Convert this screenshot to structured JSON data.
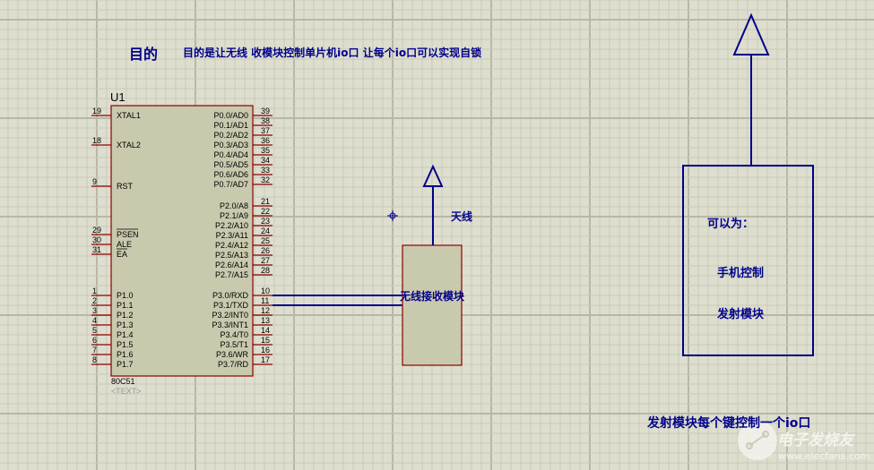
{
  "title": {
    "heading": "目的",
    "text": "目的是让无线 收模块控制单片机io口  让每个io口可以实现自锁"
  },
  "chip": {
    "ref": "U1",
    "part": "80C51",
    "text_placeholder": "<TEXT>",
    "left_pins": [
      {
        "num": "19",
        "name": "XTAL1"
      },
      {
        "num": "18",
        "name": "XTAL2"
      },
      {
        "num": "9",
        "name": "RST"
      },
      {
        "num": "29",
        "name": "PSEN",
        "bar": true
      },
      {
        "num": "30",
        "name": "ALE"
      },
      {
        "num": "31",
        "name": "EA",
        "bar": true
      },
      {
        "num": "1",
        "name": "P1.0"
      },
      {
        "num": "2",
        "name": "P1.1"
      },
      {
        "num": "3",
        "name": "P1.2"
      },
      {
        "num": "4",
        "name": "P1.3"
      },
      {
        "num": "5",
        "name": "P1.4"
      },
      {
        "num": "6",
        "name": "P1.5"
      },
      {
        "num": "7",
        "name": "P1.6"
      },
      {
        "num": "8",
        "name": "P1.7"
      }
    ],
    "right_pins": [
      {
        "num": "39",
        "name": "P0.0/AD0"
      },
      {
        "num": "38",
        "name": "P0.1/AD1"
      },
      {
        "num": "37",
        "name": "P0.2/AD2"
      },
      {
        "num": "36",
        "name": "P0.3/AD3"
      },
      {
        "num": "35",
        "name": "P0.4/AD4"
      },
      {
        "num": "34",
        "name": "P0.5/AD5"
      },
      {
        "num": "33",
        "name": "P0.6/AD6"
      },
      {
        "num": "32",
        "name": "P0.7/AD7"
      },
      {
        "num": "21",
        "name": "P2.0/A8"
      },
      {
        "num": "22",
        "name": "P2.1/A9"
      },
      {
        "num": "23",
        "name": "P2.2/A10"
      },
      {
        "num": "24",
        "name": "P2.3/A11"
      },
      {
        "num": "25",
        "name": "P2.4/A12"
      },
      {
        "num": "26",
        "name": "P2.5/A13"
      },
      {
        "num": "27",
        "name": "P2.6/A14"
      },
      {
        "num": "28",
        "name": "P2.7/A15"
      },
      {
        "num": "10",
        "name": "P3.0/RXD"
      },
      {
        "num": "11",
        "name": "P3.1/TXD"
      },
      {
        "num": "12",
        "name": "P3.2/INT0"
      },
      {
        "num": "13",
        "name": "P3.3/INT1"
      },
      {
        "num": "14",
        "name": "P3.4/T0"
      },
      {
        "num": "15",
        "name": "P3.5/T1"
      },
      {
        "num": "16",
        "name": "P3.6/WR"
      },
      {
        "num": "17",
        "name": "P3.7/RD"
      }
    ]
  },
  "receiver": {
    "antenna_label": "天线",
    "module_label": "无线接收模块"
  },
  "transmitter": {
    "line1": "可以为：",
    "line2": "手机控制",
    "line3": "发射模块"
  },
  "note": "发射模块每个键控制一个io口",
  "watermark": {
    "brand": "电子发烧友",
    "url": "www.elecfans.com"
  },
  "colors": {
    "background": "#dedecf",
    "grid": "#c8c8b8",
    "wire": "#00008b",
    "chip_fill": "#c9c9ae",
    "chip_border": "#8b0000"
  }
}
